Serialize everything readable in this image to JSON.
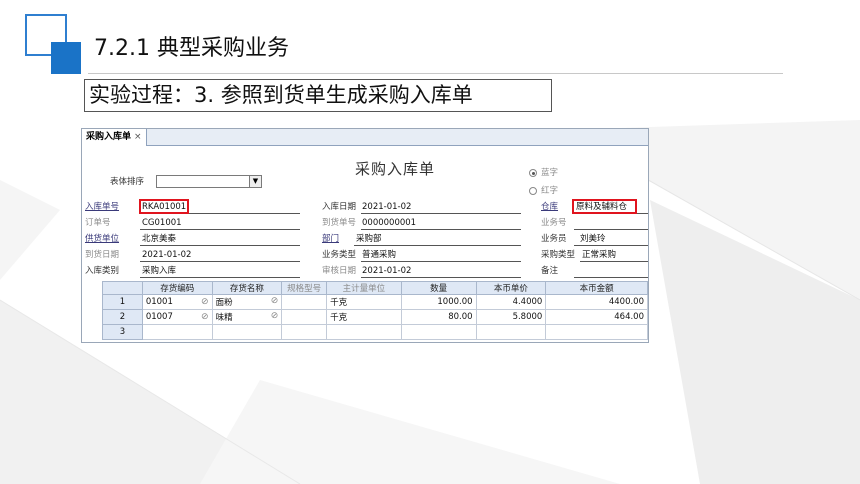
{
  "slide": {
    "title": "7.2.1  典型采购业务",
    "subtitle": "实验过程：3. 参照到货单生成采购入库单"
  },
  "window": {
    "tab_label": "采购入库单",
    "tab_close": "×",
    "form_title": "采购入库单",
    "sort_label": "表体排序",
    "radio_blue": "蓝字",
    "radio_red": "红字",
    "fields": {
      "receipt_no_label": "入库单号",
      "receipt_no": "RKA01001",
      "order_no_label": "订单号",
      "order_no": "CG01001",
      "supplier_label": "供货单位",
      "supplier": "北京美秦",
      "arrival_date_label": "到货日期",
      "arrival_date": "2021-01-02",
      "receipt_type_label": "入库类别",
      "receipt_type": "采购入库",
      "receipt_date_label": "入库日期",
      "receipt_date": "2021-01-02",
      "arrival_no_label": "到货单号",
      "arrival_no": "0000000001",
      "dept_label": "部门",
      "dept": "采购部",
      "biz_type_label": "业务类型",
      "biz_type": "普通采购",
      "audit_date_label": "审核日期",
      "audit_date": "2021-01-02",
      "warehouse_label": "仓库",
      "warehouse": "原料及辅料仓",
      "biz_no_label": "业务号",
      "salesman_label": "业务员",
      "salesman": "刘美玲",
      "purchase_type_label": "采购类型",
      "purchase_type": "正常采购",
      "remark_label": "备注"
    },
    "table": {
      "headers": [
        "",
        "存货编码",
        "存货名称",
        "规格型号",
        "主计量单位",
        "数量",
        "本币单价",
        "本币金额"
      ],
      "rows": [
        {
          "n": "1",
          "code": "01001",
          "name": "面粉",
          "spec": "",
          "unit": "千克",
          "qty": "1000.00",
          "price": "4.4000",
          "amount": "4400.00"
        },
        {
          "n": "2",
          "code": "01007",
          "name": "味精",
          "spec": "",
          "unit": "千克",
          "qty": "80.00",
          "price": "5.8000",
          "amount": "464.00"
        },
        {
          "n": "3",
          "code": "",
          "name": "",
          "spec": "",
          "unit": "",
          "qty": "",
          "price": "",
          "amount": ""
        }
      ]
    }
  },
  "colors": {
    "accent": "#1a73c7",
    "highlight": "#e0141e",
    "header_bg": "#dfe8f5"
  },
  "icons": {
    "attachment": "paperclip-icon",
    "dropdown": "chevron-down-icon"
  }
}
